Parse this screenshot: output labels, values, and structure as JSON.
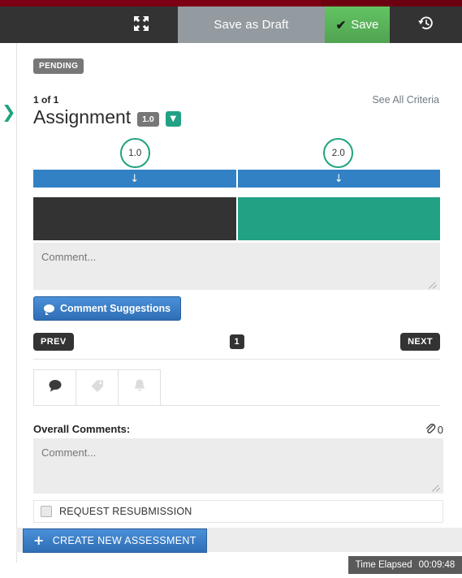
{
  "toolbar": {
    "expand_icon": "expand-arrows-icon",
    "save_draft_label": "Save as Draft",
    "save_label": "Save",
    "save_check_icon": "check-icon",
    "history_icon": "history-revert-icon"
  },
  "rail": {
    "chevron_icon": "chevron-right-icon"
  },
  "status": {
    "badge": "PENDING"
  },
  "header": {
    "count": "1 of 1",
    "see_all_criteria": "See All Criteria",
    "title": "Assignment",
    "title_badge": "1.0",
    "caret_icon": "chevron-down-icon"
  },
  "criteria": {
    "scores": [
      "1.0",
      "2.0"
    ],
    "arrow_icon": "arrow-down-icon",
    "levels": [
      {
        "name": "level-unselected",
        "color": "#333333"
      },
      {
        "name": "level-selected",
        "color": "#22a185"
      }
    ],
    "comment_placeholder": "Comment...",
    "comment_value": "",
    "suggestions_label": "Comment Suggestions",
    "suggestions_icon": "speech-bubble-icon"
  },
  "pager": {
    "prev_label": "PREV",
    "next_label": "NEXT",
    "page": "1"
  },
  "tabs": [
    {
      "name": "tab-comments",
      "icon": "speech-bubble-icon",
      "active": true
    },
    {
      "name": "tab-tags",
      "icon": "tag-icon",
      "active": false
    },
    {
      "name": "tab-alerts",
      "icon": "bell-icon",
      "active": false
    }
  ],
  "overall": {
    "label": "Overall Comments:",
    "attachment_icon": "paperclip-icon",
    "attachment_count": "0",
    "comment_placeholder": "Comment...",
    "comment_value": ""
  },
  "resubmission": {
    "label": "REQUEST RESUBMISSION",
    "checked": false
  },
  "footer": {
    "create_label": "CREATE NEW ASSESSMENT",
    "plus_icon": "plus-icon",
    "time_label": "Time Elapsed",
    "time_value": "00:09:48"
  },
  "colors": {
    "accent_red": "#7d0014",
    "toolbar_dark": "#333333",
    "save_green": "#5cb85c",
    "teal": "#22a185",
    "blue": "#3281c4",
    "gray_badge": "#777777"
  }
}
